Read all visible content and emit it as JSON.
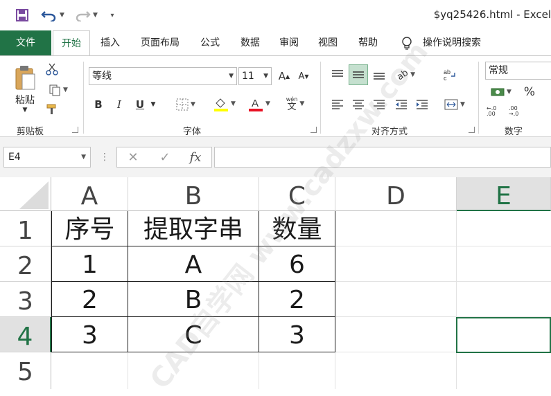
{
  "window": {
    "title": "$yq25426.html  -  Excel"
  },
  "quick_access": {
    "save_icon": "save-icon",
    "undo_icon": "undo-icon",
    "redo_icon": "redo-icon",
    "customize_icon": "customize-icon"
  },
  "tabs": [
    {
      "label": "文件"
    },
    {
      "label": "开始"
    },
    {
      "label": "插入"
    },
    {
      "label": "页面布局"
    },
    {
      "label": "公式"
    },
    {
      "label": "数据"
    },
    {
      "label": "审阅"
    },
    {
      "label": "视图"
    },
    {
      "label": "帮助"
    }
  ],
  "tell_me": {
    "label": "操作说明搜索"
  },
  "ribbon": {
    "clipboard": {
      "label": "剪贴板",
      "paste_label": "粘贴"
    },
    "font": {
      "label": "字体",
      "font_name": "等线",
      "font_size": "11",
      "bold": "B",
      "italic": "I",
      "underline": "U",
      "phonetic": "wén"
    },
    "alignment": {
      "label": "对齐方式"
    },
    "number": {
      "label": "数字",
      "format": "常规",
      "percent": "%",
      "inc_decimal": "←.0 .00",
      "dec_decimal": ".00 →.0"
    }
  },
  "formula_bar": {
    "name_box": "E4",
    "fx": "fx",
    "value": ""
  },
  "grid": {
    "columns": [
      "A",
      "B",
      "C",
      "D",
      "E"
    ],
    "rows": [
      "1",
      "2",
      "3",
      "4",
      "5"
    ],
    "selected_column": "E",
    "selected_row": "4",
    "active_cell": "E4",
    "cells": [
      [
        "序号",
        "提取字串",
        "数量"
      ],
      [
        "1",
        "A",
        "6"
      ],
      [
        "2",
        "B",
        "2"
      ],
      [
        "3",
        "C",
        "3"
      ]
    ]
  },
  "watermark": {
    "text": "CAD自学网 www.cadzxw.com"
  },
  "colors": {
    "excel_green": "#217346",
    "accent_blue": "#2b579a"
  }
}
